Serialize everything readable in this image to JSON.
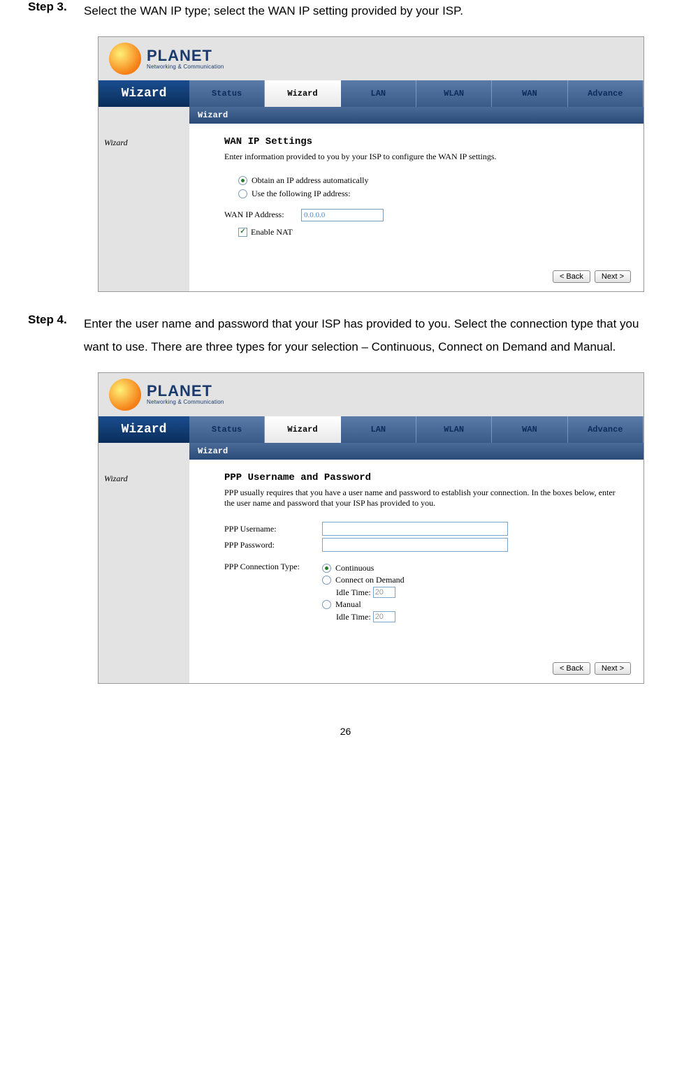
{
  "step3": {
    "label": "Step 3.",
    "text": "Select the WAN IP type; select the WAN IP setting provided by your ISP."
  },
  "step4": {
    "label": "Step 4.",
    "text": "Enter the user name and password that your ISP has provided to you. Select the connection type that you want to use. There are three types for your selection – Continuous, Connect on Demand and Manual."
  },
  "logo": {
    "name": "PLANET",
    "sub": "Networking & Communication"
  },
  "nav": {
    "title": "Wizard",
    "items": [
      "Status",
      "Wizard",
      "LAN",
      "WLAN",
      "WAN",
      "Advance"
    ],
    "sub": "Wizard"
  },
  "side_label": "Wizard",
  "wan": {
    "title": "WAN IP Settings",
    "desc": "Enter information provided to you by your ISP to configure the WAN IP settings.",
    "opt_auto": "Obtain an IP address automatically",
    "opt_static": "Use the following IP address:",
    "ip_label": "WAN IP Address:",
    "ip_value": "0.0.0.0",
    "nat_label": "Enable NAT"
  },
  "ppp": {
    "title": "PPP Username and Password",
    "desc": "PPP usually requires that you have a user name and password to establish your connection. In the boxes below, enter the user name and password that your ISP has provided to you.",
    "user_label": "PPP Username:",
    "pass_label": "PPP Password:",
    "conn_label": "PPP Connection Type:",
    "opt_cont": "Continuous",
    "opt_demand": "Connect on Demand",
    "opt_manual": "Manual",
    "idle_label": "Idle Time:",
    "idle_value": "20"
  },
  "buttons": {
    "back": "< Back",
    "next": "Next >"
  },
  "page_num": "26"
}
